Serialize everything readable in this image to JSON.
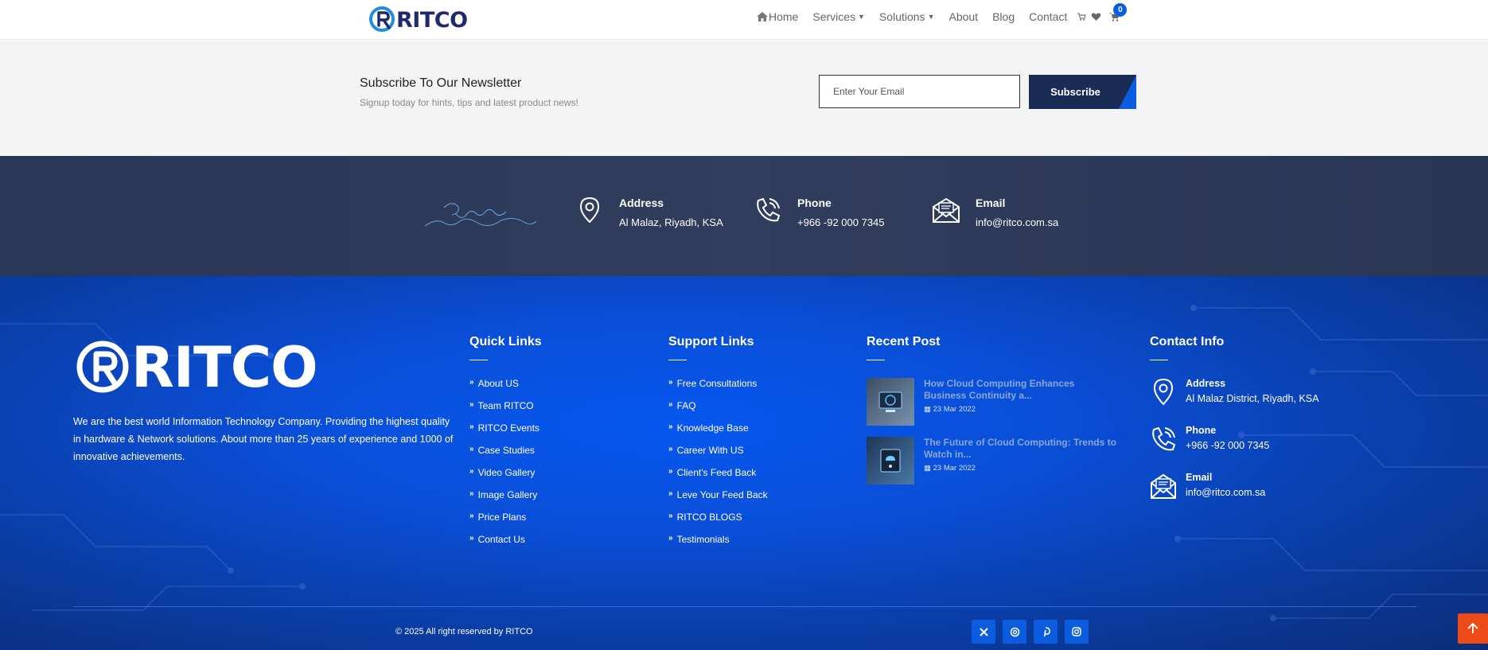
{
  "header": {
    "brand": "RITCO",
    "nav": [
      {
        "label": "Home"
      },
      {
        "label": "Services"
      },
      {
        "label": "Solutions"
      },
      {
        "label": "About"
      },
      {
        "label": "Blog"
      },
      {
        "label": "Contact"
      }
    ],
    "cart_count": "0"
  },
  "newsletter": {
    "title": "Subscribe To Our Newsletter",
    "subtitle": "Signup today for hints, tips and latest product news!",
    "placeholder": "Enter Your Email",
    "button": "Subscribe"
  },
  "info_strip": {
    "address_label": "Address",
    "address_value": "Al Malaz, Riyadh, KSA",
    "phone_label": "Phone",
    "phone_value": "+966 -92 000 7345",
    "email_label": "Email",
    "email_value": "info@ritco.com.sa"
  },
  "footer": {
    "brand": "RITCO",
    "about": "We are the best world Information Technology Company. Providing the highest quality in hardware & Network solutions. About more than 25 years of experience and 1000 of innovative achievements.",
    "quick_links": {
      "title": "Quick Links",
      "items": [
        "About US",
        "Team RITCO",
        "RITCO Events",
        "Case Studies",
        "Video Gallery",
        "Image Gallery",
        "Price Plans",
        "Contact Us"
      ]
    },
    "support_links": {
      "title": "Support Links",
      "items": [
        "Free Consultations",
        "FAQ",
        "Knowledge Base",
        "Career With US",
        "Client's Feed Back",
        "Leve Your Feed Back",
        "RITCO BLOGS",
        "Testimonials"
      ]
    },
    "recent_posts": {
      "title": "Recent Post",
      "items": [
        {
          "title": "How Cloud Computing Enhances Business Continuity a...",
          "date": "23 Mar 2022"
        },
        {
          "title": "The Future of Cloud Computing: Trends to Watch in...",
          "date": "23 Mar 2022"
        }
      ]
    },
    "contact_info": {
      "title": "Contact Info",
      "address_label": "Address",
      "address_value": "Al Malaz District, Riyadh, KSA",
      "phone_label": "Phone",
      "phone_value": "+966 -92 000 7345",
      "email_label": "Email",
      "email_value": "info@ritco.com.sa"
    },
    "copyright": "© 2025 All right reserved by RITCO",
    "social": [
      "x-icon",
      "threads-icon",
      "pinterest-icon",
      "instagram-icon"
    ]
  },
  "colors": {
    "brand_navy": "#1f2a6b",
    "accent_blue": "#0b5cde",
    "scroll_top": "#ec4b17"
  }
}
